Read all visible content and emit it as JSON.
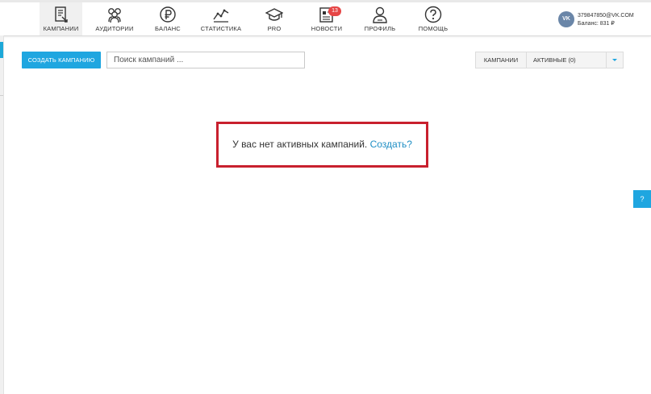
{
  "nav": {
    "items": [
      {
        "label": "КАМПАНИИ",
        "icon": "campaigns-icon"
      },
      {
        "label": "АУДИТОРИИ",
        "icon": "audiences-icon"
      },
      {
        "label": "БАЛАНС",
        "icon": "ruble-icon"
      },
      {
        "label": "СТАТИСТИКА",
        "icon": "statistics-icon"
      },
      {
        "label": "PRO",
        "icon": "graduation-cap-icon"
      },
      {
        "label": "НОВОСТИ",
        "icon": "news-icon"
      },
      {
        "label": "ПРОФИЛЬ",
        "icon": "profile-icon"
      },
      {
        "label": "ПОМОЩЬ",
        "icon": "help-icon"
      }
    ],
    "news_badge": "13"
  },
  "account": {
    "avatar_text": "VK",
    "email": "379847850@VK.COM",
    "balance": "Баланс: 831 ₽"
  },
  "toolbar": {
    "create_label": "СОЗДАТЬ КАМПАНИЮ",
    "search_placeholder": "Поиск кампаний ...",
    "filter_type": "КАМПАНИИ",
    "filter_status": "АКТИВНЫЕ (0)"
  },
  "empty_state": {
    "message": "У вас нет активных кампаний.",
    "link": "Создать?"
  },
  "help_tab": "?",
  "colors": {
    "accent": "#1fa6e0",
    "badge": "#e64646",
    "highlight_border": "#c8202e",
    "link": "#1e8ec4"
  }
}
